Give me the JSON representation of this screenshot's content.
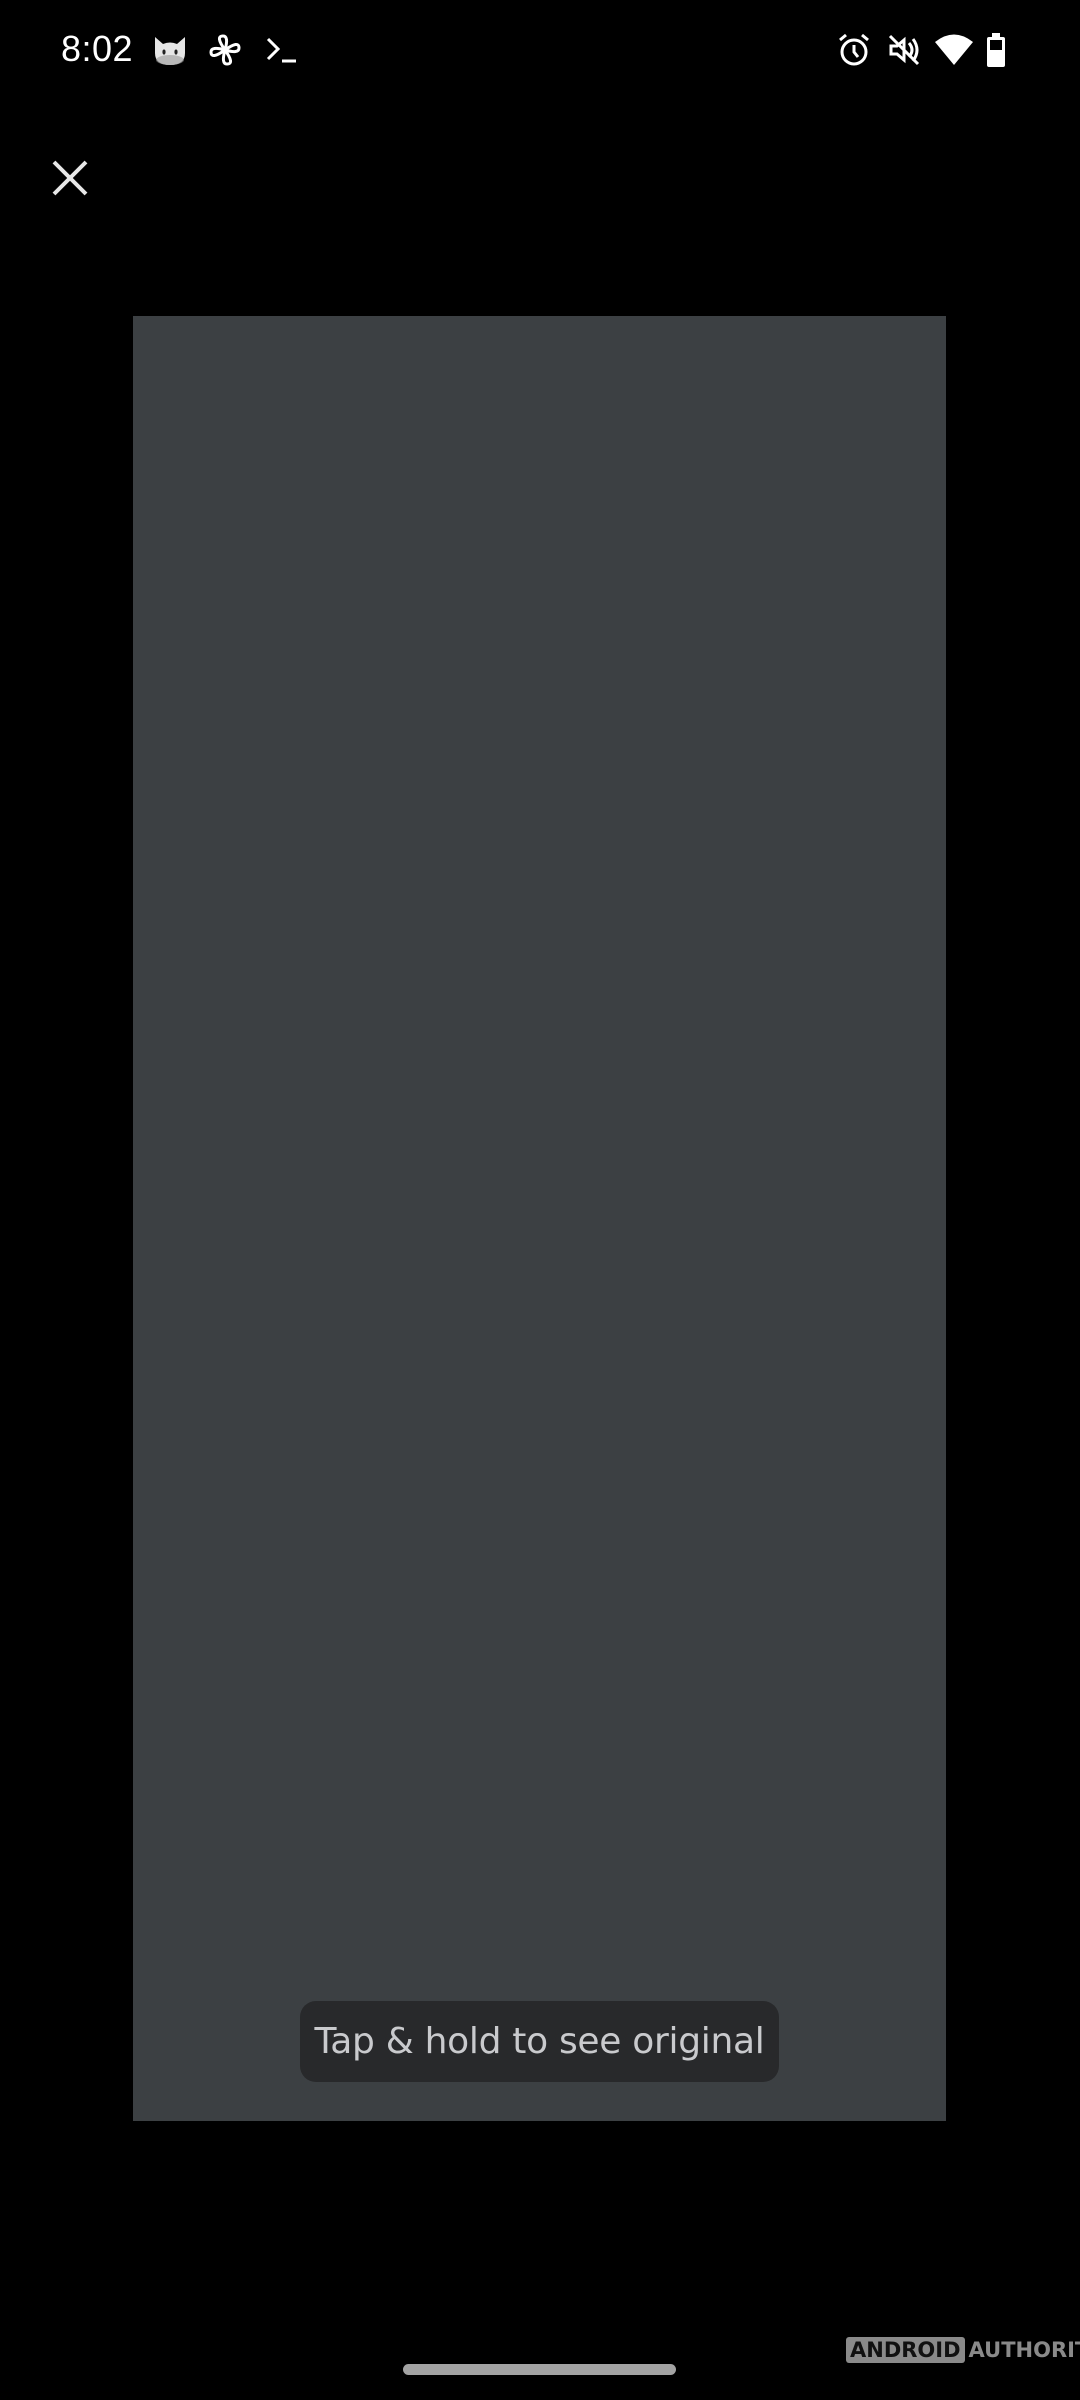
{
  "status_bar": {
    "time": "8:02",
    "left_icons": [
      "cat-app-icon",
      "pinwheel-icon",
      "terminal-icon"
    ],
    "right_icons": [
      "alarm-icon",
      "muted-icon",
      "wifi-icon",
      "battery-icon"
    ]
  },
  "toolbar": {
    "close_icon": "close-icon"
  },
  "image_viewer": {
    "panel_color": "#3c4043",
    "tooltip_text": "Tap & hold to see original"
  },
  "watermark": {
    "boxed": "ANDROID",
    "plain": "AUTHORITY"
  }
}
